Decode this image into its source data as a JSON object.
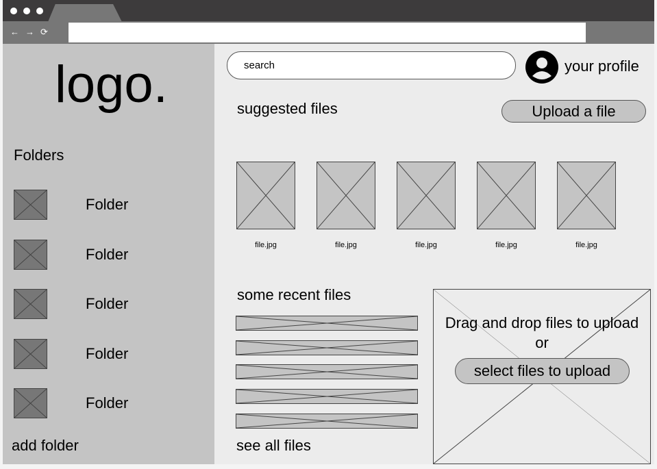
{
  "browser": {
    "nav": {
      "back": "←",
      "forward": "→",
      "reload": "⟳"
    }
  },
  "sidebar": {
    "logo": "logo.",
    "folders_heading": "Folders",
    "folders": [
      {
        "label": "Folder"
      },
      {
        "label": "Folder"
      },
      {
        "label": "Folder"
      },
      {
        "label": "Folder"
      },
      {
        "label": "Folder"
      }
    ],
    "add_folder": "add folder"
  },
  "header": {
    "search_placeholder": "search",
    "profile": "your profile"
  },
  "suggested": {
    "heading": "suggested files",
    "upload_button": "Upload a file",
    "files": [
      {
        "name": "file.jpg"
      },
      {
        "name": "file.jpg"
      },
      {
        "name": "file.jpg"
      },
      {
        "name": "file.jpg"
      },
      {
        "name": "file.jpg"
      }
    ]
  },
  "recent": {
    "heading": "some recent files",
    "see_all": "see all files"
  },
  "dropzone": {
    "text": "Drag and drop files to upload",
    "or": "or",
    "select_button": "select files to upload"
  }
}
